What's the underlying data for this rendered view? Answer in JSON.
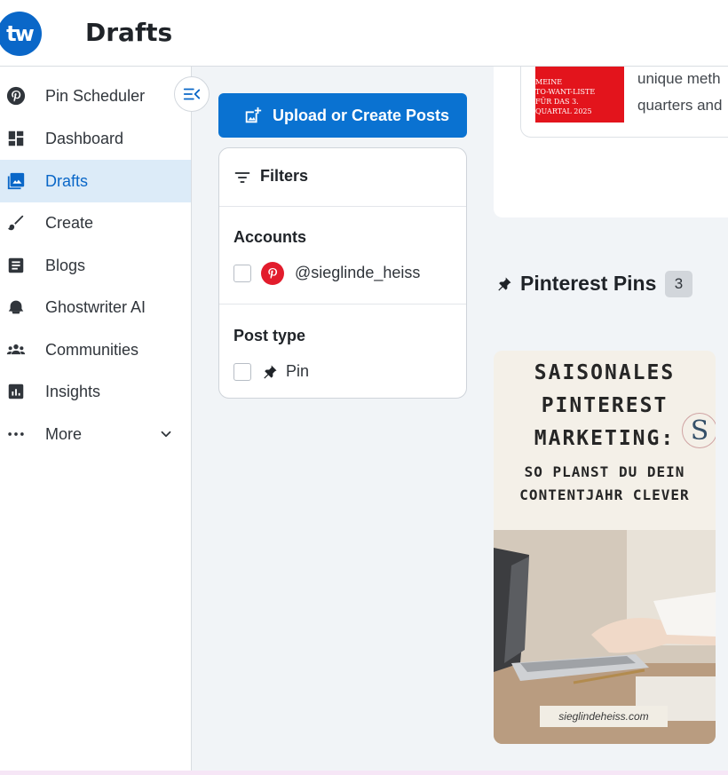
{
  "header": {
    "logo_text": "tw",
    "title": "Drafts"
  },
  "sidebar": {
    "items": [
      {
        "label": "Pin Scheduler",
        "icon": "pinterest-icon"
      },
      {
        "label": "Dashboard",
        "icon": "dashboard-icon"
      },
      {
        "label": "Drafts",
        "icon": "image-icon",
        "active": true
      },
      {
        "label": "Create",
        "icon": "brush-icon"
      },
      {
        "label": "Blogs",
        "icon": "article-icon"
      },
      {
        "label": "Ghostwriter AI",
        "icon": "ghost-icon"
      },
      {
        "label": "Communities",
        "icon": "group-icon"
      },
      {
        "label": "Insights",
        "icon": "bar-chart-icon"
      },
      {
        "label": "More",
        "icon": "more-horizontal-icon"
      }
    ]
  },
  "toolbar": {
    "upload_label": "Upload or Create Posts"
  },
  "filters": {
    "title": "Filters",
    "accounts_title": "Accounts",
    "account_handle": "@sieglinde_heiss",
    "post_type_title": "Post type",
    "post_type_option": "Pin"
  },
  "blog_preview": {
    "thumb_lines": [
      "MEINE",
      "TO-WANT-LISTE",
      "FÜR DAS 3.",
      "QUARTAL 2025"
    ],
    "text_line_1": "unique meth",
    "text_line_2": "quarters and"
  },
  "pins_section": {
    "title": "Pinterest Pins",
    "count": "3"
  },
  "pin_card": {
    "lines": [
      "SAISONALES",
      "PINTEREST",
      "MARKETING:",
      "SO PLANST DU DEIN",
      "CONTENTJAHR CLEVER"
    ],
    "monogram": "S",
    "footer": "sieglindeheiss.com"
  },
  "colors": {
    "accent": "#0a72d1",
    "active_bg": "#dcebf8",
    "pinterest_red": "#e21c2c"
  }
}
